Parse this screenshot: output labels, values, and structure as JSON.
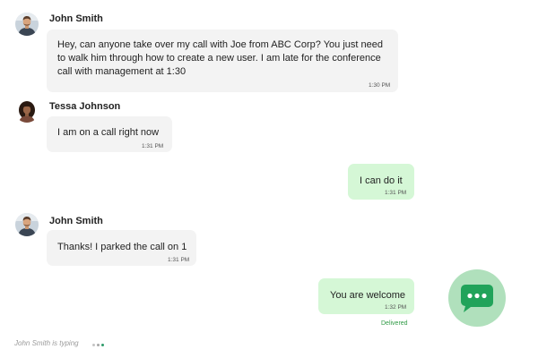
{
  "messages": [
    {
      "sender": "John Smith",
      "avatar": "man-avatar",
      "text": "Hey, can anyone take over my call with Joe from ABC Corp? You just need to walk him through how to create a new user. I am late for the conference call with management at 1:30",
      "time": "1:30 PM"
    },
    {
      "sender": "Tessa Johnson",
      "avatar": "woman-avatar",
      "text": "I am on a call right now",
      "time": "1:31 PM"
    },
    {
      "sender": "",
      "text": "I can do it",
      "time": "1:31 PM"
    },
    {
      "sender": "John Smith",
      "avatar": "man-avatar",
      "text": "Thanks! I parked the call on 1",
      "time": "1:31 PM"
    },
    {
      "sender": "",
      "text": "You are welcome",
      "time": "1:32 PM",
      "status": "Delivered"
    }
  ],
  "typing_indicator": "John Smith is typing",
  "fab": {
    "icon": "chat-bubble-icon"
  },
  "colors": {
    "incoming_bubble": "#f3f3f3",
    "outgoing_bubble": "#d5f7d6",
    "fab_background": "#b0e0bc",
    "fab_icon": "#21a35a",
    "delivered": "#2f9a45",
    "typing_text": "#9a9a9a"
  }
}
